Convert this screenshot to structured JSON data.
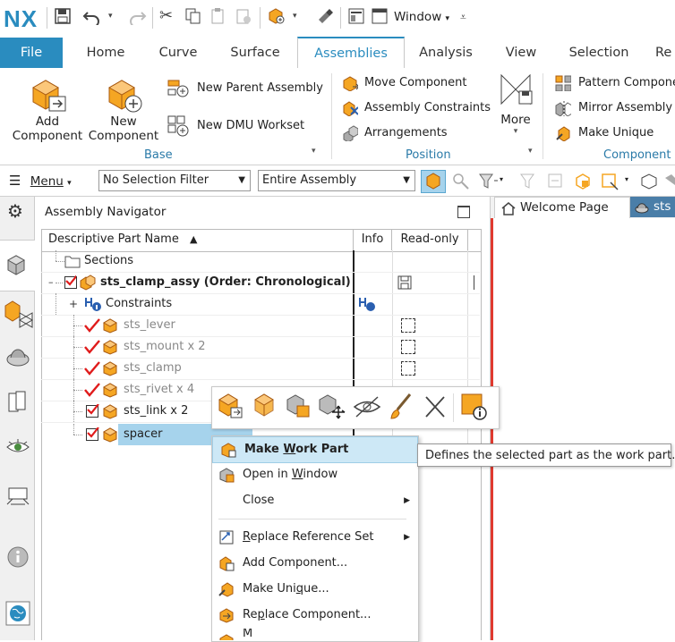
{
  "app": {
    "logo": "NX",
    "window_menu": "Window"
  },
  "tabs": [
    "File",
    "Home",
    "Curve",
    "Surface",
    "Assemblies",
    "Analysis",
    "View",
    "Selection",
    "Re"
  ],
  "ribbon": {
    "add_component": [
      "Add",
      "Component"
    ],
    "new_component": [
      "New",
      "Component"
    ],
    "new_parent_assembly": "New Parent Assembly",
    "new_dmu_workset": "New DMU Workset",
    "base_label": "Base",
    "move_component": "Move Component",
    "assembly_constraints": "Assembly Constraints",
    "arrangements": "Arrangements",
    "more": "More",
    "position_label": "Position",
    "pattern_component": "Pattern Compone",
    "mirror_assembly": "Mirror Assembly",
    "make_unique": "Make Unique",
    "component_label": "Component"
  },
  "filterbar": {
    "menu": "Menu",
    "selection_filter": "No Selection Filter",
    "scope": "Entire Assembly"
  },
  "navigator": {
    "title": "Assembly Navigator",
    "columns": [
      "Descriptive Part Name",
      "Info",
      "Read-only"
    ],
    "rows": [
      {
        "label": "Sections",
        "kind": "folder"
      },
      {
        "label": "sts_clamp_assy (Order: Chronological)",
        "kind": "assy"
      },
      {
        "label": "Constraints",
        "kind": "constraints"
      },
      {
        "label": "sts_lever",
        "kind": "part_grey"
      },
      {
        "label": "sts_mount x 2",
        "kind": "part_grey"
      },
      {
        "label": "sts_clamp",
        "kind": "part_grey"
      },
      {
        "label": "sts_rivet x 4",
        "kind": "part_grey"
      },
      {
        "label": "sts_link x 2",
        "kind": "part"
      },
      {
        "label": "spacer",
        "kind": "part_selected"
      }
    ]
  },
  "graphics_tabs": {
    "welcome": "Welcome Page",
    "part_tab": "sts"
  },
  "context_menu": {
    "items": [
      "Make Work Part",
      "Open in Window",
      "Close",
      "Replace Reference Set",
      "Add Component...",
      "Make Unique...",
      "Replace Component...",
      "M"
    ]
  },
  "tooltip": "Defines the selected part as the work part.",
  "colors": {
    "accent": "#2a8cbf",
    "file_tab": "#2a8cbf",
    "selected_row": "#a6d3ec",
    "menu_hover": "#cde8f6",
    "check_red": "#e01b1b",
    "part_orange": "#f5a623"
  }
}
